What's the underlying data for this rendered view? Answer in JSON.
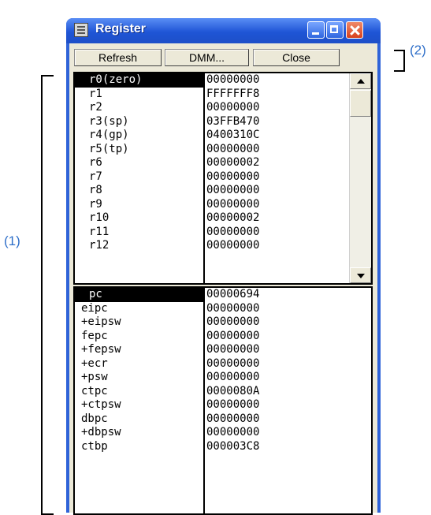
{
  "window": {
    "title": "Register",
    "icon": "register-window-icon"
  },
  "toolbar": {
    "refresh_label": "Refresh",
    "dmm_label": "DMM...",
    "close_label": "Close"
  },
  "general_registers": {
    "names": [
      "r0(zero)",
      "r1",
      "r2",
      "r3(sp)",
      "r4(gp)",
      "r5(tp)",
      "r6",
      "r7",
      "r8",
      "r9",
      "r10",
      "r11",
      "r12"
    ],
    "values": [
      "00000000",
      "FFFFFFF8",
      "00000000",
      "03FFB470",
      "0400310C",
      "00000000",
      "00000002",
      "00000000",
      "00000000",
      "00000000",
      "00000002",
      "00000000",
      "00000000"
    ],
    "selected": "r0(zero)"
  },
  "system_registers": {
    "names": [
      "pc",
      "eipc",
      "+eipsw",
      "fepc",
      "+fepsw",
      "+ecr",
      "+psw",
      "ctpc",
      "+ctpsw",
      "dbpc",
      "+dbpsw",
      "ctbp"
    ],
    "values": [
      "00000694",
      "00000000",
      "00000000",
      "00000000",
      "00000000",
      "00000000",
      "00000000",
      "0000080A",
      "00000000",
      "00000000",
      "00000000",
      "000003C8"
    ],
    "selected": "pc"
  },
  "callouts": {
    "label_1": "(1)",
    "label_2": "(2)"
  },
  "colors": {
    "titlebar": "#2f63d8",
    "callout": "#2f6fc9",
    "selection": "#000000"
  }
}
